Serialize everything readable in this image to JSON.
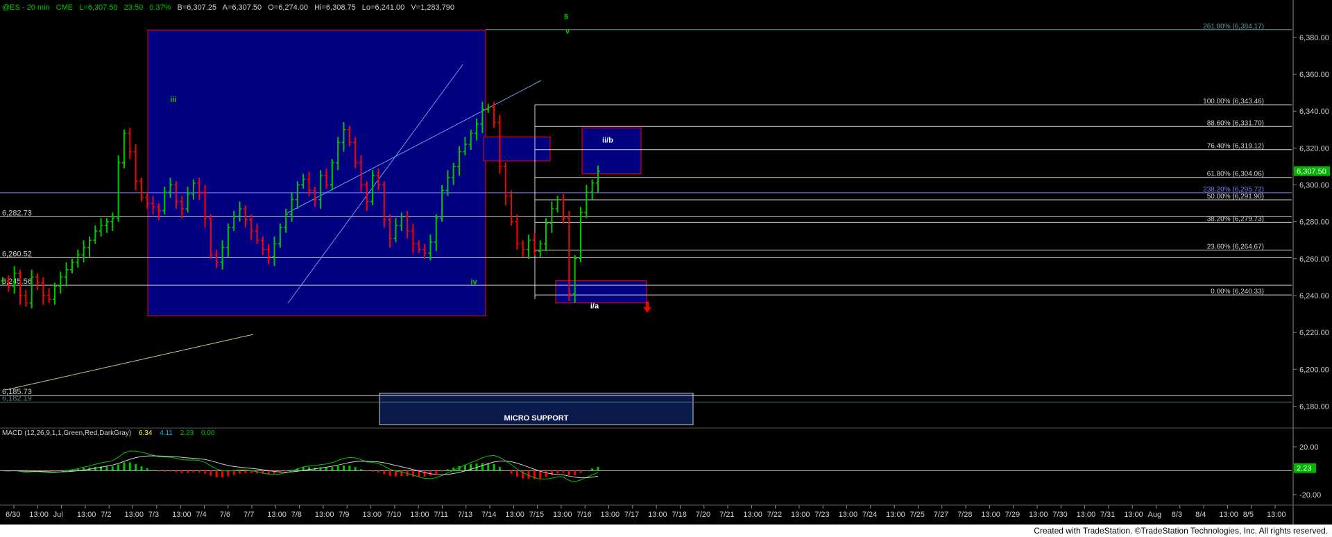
{
  "header": {
    "symbol": "@ES - 20 min",
    "exchange": "CME",
    "last": "L=6,307.50",
    "change": "23.50",
    "change_pct": "0.37%",
    "bid": "B=6,307.25",
    "ask": "A=6,307.50",
    "open": "O=6,274.00",
    "high": "Hi=6,308.75",
    "low": "Lo=6,241.00",
    "volume": "V=1,283,790"
  },
  "price_axis": {
    "ticks": [
      {
        "value": 6380,
        "label": "6,380.00"
      },
      {
        "value": 6360,
        "label": "6,360.00"
      },
      {
        "value": 6340,
        "label": "6,340.00"
      },
      {
        "value": 6320,
        "label": "6,320.00"
      },
      {
        "value": 6300,
        "label": "6,300.00"
      },
      {
        "value": 6280,
        "label": "6,280.00"
      },
      {
        "value": 6260,
        "label": "6,260.00"
      },
      {
        "value": 6240,
        "label": "6,240.00"
      },
      {
        "value": 6220,
        "label": "6,220.00"
      },
      {
        "value": 6200,
        "label": "6,200.00"
      },
      {
        "value": 6180,
        "label": "6,180.00"
      }
    ],
    "current_label": "6,307.50",
    "current_value": 6307.5
  },
  "macd": {
    "label": "MACD (12,26,9,1,1,Green,Red,DarkGray)",
    "v1": "6.34",
    "v2": "4.11",
    "v3": "2.23",
    "v4": "0.00",
    "axis": [
      {
        "value": 20,
        "label": "20.00"
      },
      {
        "value": -20,
        "label": "-20.00"
      }
    ],
    "current_label": "2.23",
    "current_value": 2.23,
    "colors": {
      "macd": "#00c800",
      "signal": "#ff0000",
      "hist_pos": "#00c800",
      "hist_neg": "#ff0000",
      "zero": "#a9a9a9"
    }
  },
  "time_axis": [
    "6/30",
    "13:00",
    "Jul",
    "13:00",
    "7/2",
    "13:00",
    "7/3",
    "13:00",
    "7/4",
    "7/6",
    "7/7",
    "13:00",
    "7/8",
    "13:00",
    "7/9",
    "13:00",
    "7/10",
    "13:00",
    "7/11",
    "7/13",
    "7/14",
    "13:00",
    "7/15",
    "13:00",
    "7/16",
    "13:00",
    "7/17",
    "13:00",
    "7/18",
    "7/20",
    "7/21",
    "13:00",
    "7/22",
    "13:00",
    "7/23",
    "13:00",
    "7/24",
    "13:00",
    "7/25",
    "7/27",
    "7/28",
    "13:00",
    "7/29",
    "13:00",
    "7/30",
    "13:00",
    "7/31",
    "13:00",
    "Aug",
    "8/3",
    "8/4",
    "13:00",
    "8/5",
    "13:00"
  ],
  "chart_data": {
    "type": "candlestick",
    "symbol": "@ES",
    "interval": "20 min",
    "ylim": [
      6170,
      6392
    ],
    "price_bars_close": [
      6248,
      6245,
      6252,
      6240,
      6236,
      6250,
      6247,
      6240,
      6238,
      6245,
      6250,
      6254,
      6258,
      6262,
      6266,
      6270,
      6275,
      6278,
      6280,
      6282,
      6312,
      6328,
      6318,
      6302,
      6293,
      6290,
      6288,
      6286,
      6296,
      6300,
      6291,
      6287,
      6295,
      6301,
      6296,
      6282,
      6262,
      6258,
      6266,
      6277,
      6283,
      6287,
      6281,
      6275,
      6270,
      6265,
      6261,
      6268,
      6277,
      6284,
      6292,
      6300,
      6303,
      6297,
      6292,
      6305,
      6300,
      6312,
      6323,
      6330,
      6323,
      6312,
      6300,
      6291,
      6305,
      6300,
      6281,
      6271,
      6278,
      6283,
      6275,
      6268,
      6265,
      6263,
      6269,
      6282,
      6297,
      6304,
      6310,
      6318,
      6322,
      6328,
      6333,
      6341,
      6342,
      6334,
      6310,
      6294,
      6280,
      6268,
      6265,
      6270,
      6264,
      6268,
      6279,
      6287,
      6292,
      6282,
      6241,
      6260,
      6285,
      6296,
      6301,
      6307.5
    ],
    "levels_left": [
      {
        "label": "6,282.73",
        "value": 6282.73
      },
      {
        "label": "6,260.52",
        "value": 6260.52
      },
      {
        "label": "6,245.56",
        "value": 6245.56
      },
      {
        "label": "6,185.73",
        "value": 6185.73
      },
      {
        "label": "6,182.19",
        "value": 6182.19
      }
    ],
    "fib_levels": [
      {
        "label": "261.80% (6,384.17)",
        "value": 6384.17,
        "color": "#5f9ea0"
      },
      {
        "label": "100.00% (6,343.46)",
        "value": 6343.46,
        "color": "#d8d8d8"
      },
      {
        "label": "88.60% (6,331.70)",
        "value": 6331.7,
        "color": "#d8d8d8"
      },
      {
        "label": "76.40% (6,319.12)",
        "value": 6319.12,
        "color": "#d8d8d8"
      },
      {
        "label": "61.80% (6,304.06)",
        "value": 6304.06,
        "color": "#d8d8d8"
      },
      {
        "label": "238.20% (6,295.72)",
        "value": 6295.72,
        "color": "#8080ff"
      },
      {
        "label": "50.00% (6,291.90)",
        "value": 6291.9,
        "color": "#d8d8d8"
      },
      {
        "label": "38.20% (6,279.73)",
        "value": 6279.73,
        "color": "#d8d8d8"
      },
      {
        "label": "23.60% (6,264.67)",
        "value": 6264.67,
        "color": "#d8d8d8"
      },
      {
        "label": "0.00% (6,240.33)",
        "value": 6240.33,
        "color": "#d8d8d8"
      }
    ],
    "wave_labels": [
      {
        "text": "iii",
        "value": 6345,
        "color": "#00c800"
      },
      {
        "text": "5",
        "value": 6390,
        "color": "#00c800"
      },
      {
        "text": "v",
        "value": 6382,
        "color": "#00c800"
      },
      {
        "text": "iv",
        "value": 6246,
        "color": "#00c800"
      },
      {
        "text": "ii/b",
        "value": 6323,
        "color": "#ffffff"
      },
      {
        "text": "i/a",
        "value": 6233,
        "color": "#ffffff"
      }
    ],
    "zones": [
      {
        "label": "",
        "top": 6384,
        "bottom": 6229,
        "fill": "#000080"
      },
      {
        "label": "",
        "top": 6326,
        "bottom": 6313,
        "fill": "#000080"
      },
      {
        "label": "",
        "top": 6331,
        "bottom": 6306,
        "fill": "#000080"
      },
      {
        "label": "",
        "top": 6248,
        "bottom": 6236,
        "fill": "#000080"
      },
      {
        "label": "MICRO SUPPORT",
        "top": 6187,
        "bottom": 6170,
        "fill": "#0a1a4a"
      }
    ],
    "current_price": 6307.5,
    "colors": {
      "up": "#00c800",
      "down": "#ff0000",
      "zone_border": "#ff0000",
      "arrow": "#ff0000",
      "grid": "#1c1c1c"
    }
  },
  "footer": {
    "text": "Created with TradeStation. ©TradeStation Technologies, Inc. All rights reserved."
  }
}
